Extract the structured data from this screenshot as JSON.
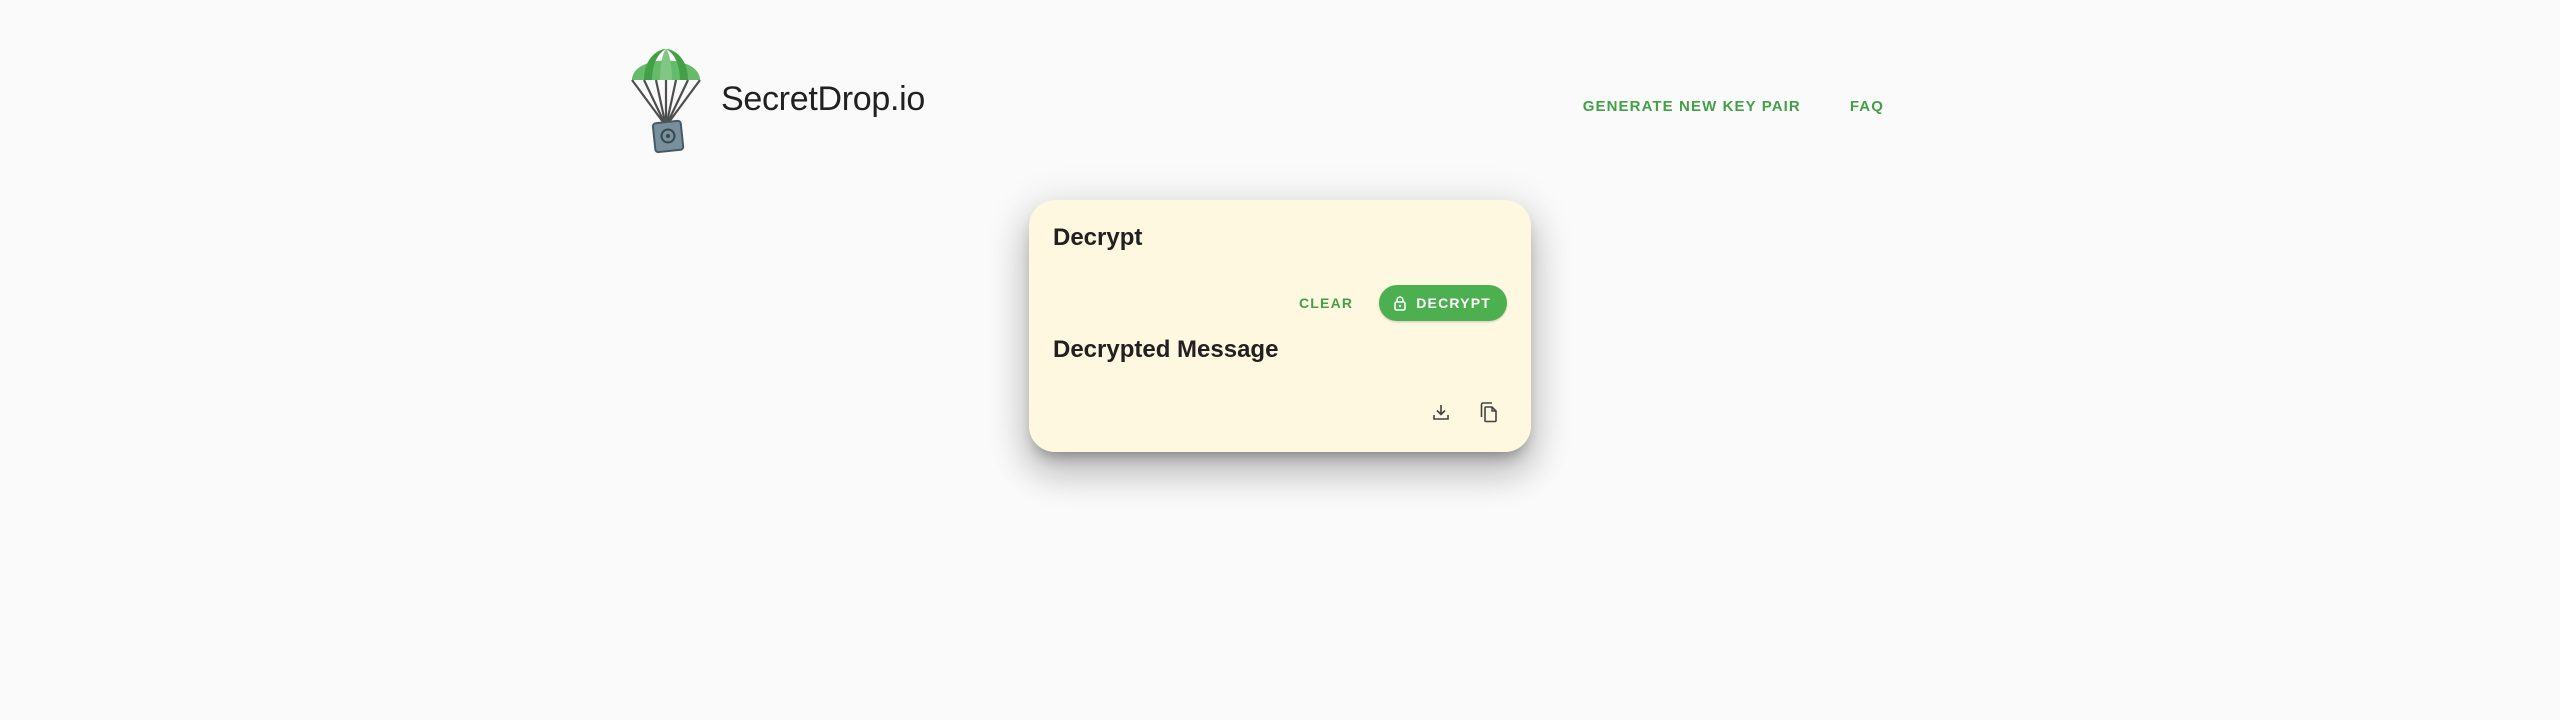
{
  "header": {
    "brand": "SecretDrop.io",
    "logo_icon": "parachute-safe-icon",
    "nav": {
      "generate": "GENERATE NEW KEY PAIR",
      "faq": "FAQ"
    }
  },
  "card": {
    "title": "Decrypt",
    "clear_label": "CLEAR",
    "decrypt_label": "DECRYPT",
    "decrypt_icon": "lock-open-icon",
    "message_title": "Decrypted Message",
    "download_icon": "download-icon",
    "copy_icon": "copy-icon"
  },
  "colors": {
    "accent": "#4caf50",
    "accent_text": "#43a047",
    "card_bg": "#fff8e1",
    "page_bg": "#fafafa"
  }
}
